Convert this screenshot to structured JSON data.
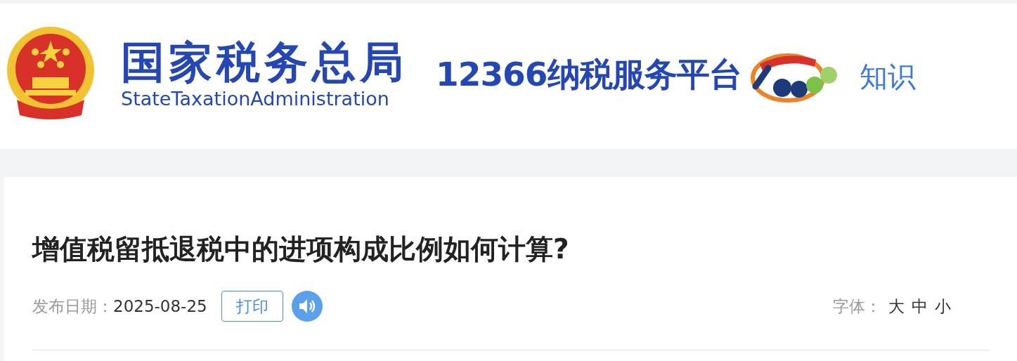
{
  "header": {
    "org_name": "国家税务总局",
    "org_name_en": "StateTaxationAdministration",
    "platform": "12366纳税服务平台",
    "nav_link": "知识"
  },
  "article": {
    "title": "增值税留抵退税中的进项构成比例如何计算?",
    "date_label": "发布日期：",
    "date": "2025-08-25",
    "print_button": "打印",
    "font_label": "字体：",
    "font_sizes": [
      {
        "label": "大"
      },
      {
        "label": "中"
      },
      {
        "label": "小"
      }
    ]
  }
}
